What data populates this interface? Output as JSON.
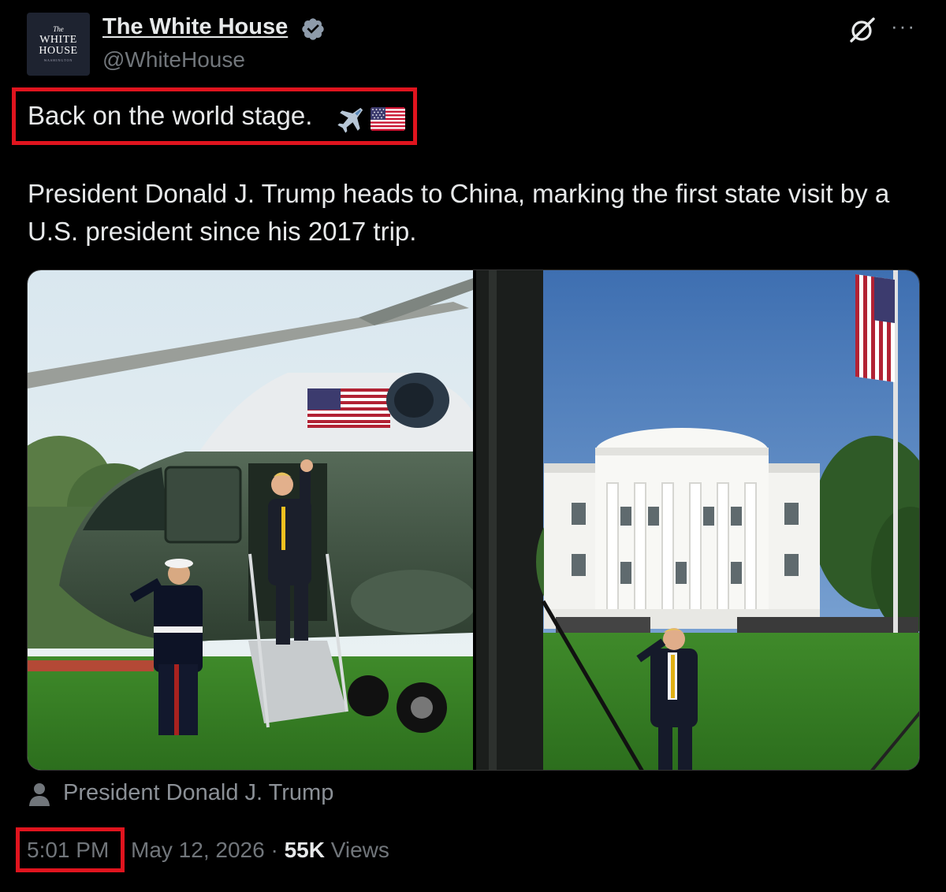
{
  "post": {
    "avatar": {
      "line_the": "The",
      "line1": "WHITE",
      "line2": "HOUSE",
      "line_sub": "WASHINGTON"
    },
    "author_name": "The White House",
    "handle": "@WhiteHouse",
    "headline": "Back on the world stage.",
    "body": "President Donald J. Trump heads to China, marking the first state visit by a U.S. president since his 2017 trip.",
    "more_label": "···",
    "media_credit": "President Donald J. Trump",
    "time": "5:01 PM",
    "date": "May 12, 2026",
    "separator": "·",
    "views_count": "55K",
    "views_label": "Views"
  },
  "colors": {
    "accent_highlight": "#e0141e",
    "verified": "#8e9baa",
    "muted": "#71767b"
  },
  "icons": [
    "verified-badge-icon",
    "grok-icon",
    "more-icon",
    "airplane-emoji-icon",
    "us-flag-emoji-icon",
    "person-icon"
  ]
}
